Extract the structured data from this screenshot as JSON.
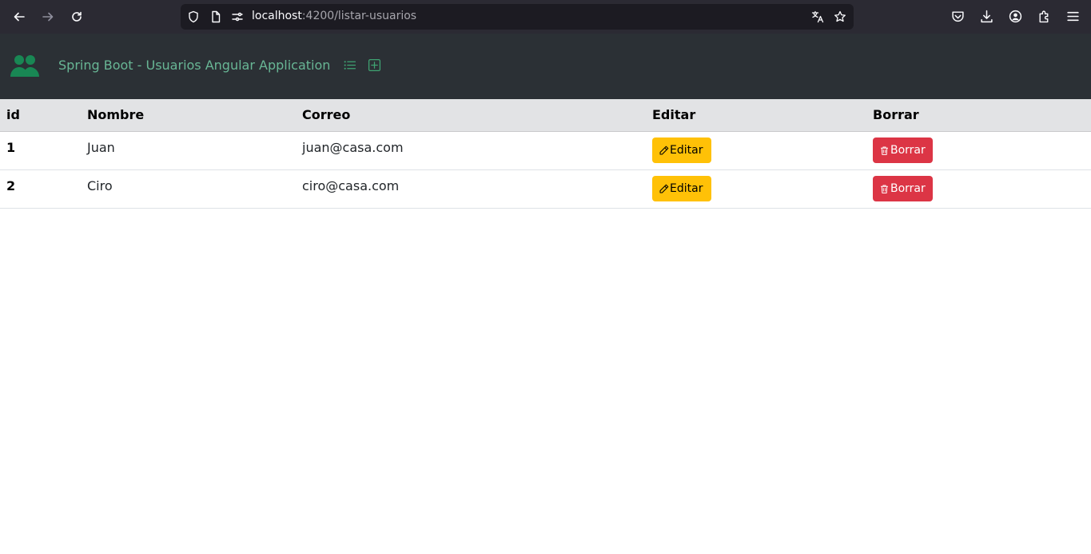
{
  "browser": {
    "url_host": "localhost",
    "url_path": ":4200/listar-usuarios"
  },
  "header": {
    "brand": "Spring Boot - Usuarios Angular Application",
    "accent_color": "#68b695"
  },
  "table": {
    "columns": [
      "id",
      "Nombre",
      "Correo",
      "Editar",
      "Borrar"
    ],
    "rows": [
      {
        "id": "1",
        "nombre": "Juan",
        "correo": "juan@casa.com",
        "edit_label": "Editar",
        "delete_label": "Borrar"
      },
      {
        "id": "2",
        "nombre": "Ciro",
        "correo": "ciro@casa.com",
        "edit_label": "Editar",
        "delete_label": "Borrar"
      }
    ]
  },
  "colors": {
    "edit_button": "#ffc107",
    "delete_button": "#dc3545",
    "header_bg": "#2b3035"
  }
}
